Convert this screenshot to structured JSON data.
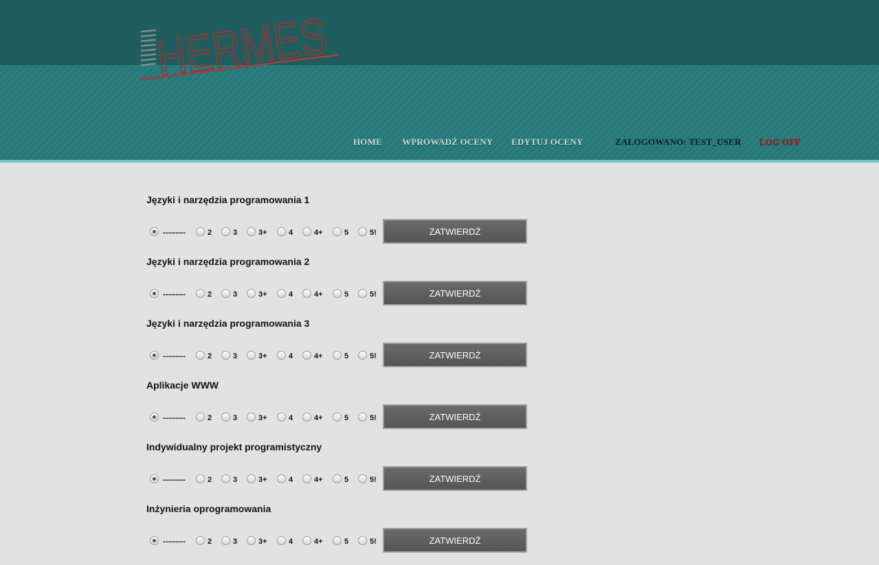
{
  "header": {
    "logo_text": "HERMES",
    "nav": {
      "home": "HOME",
      "enter_grades": "WPROWADŹ OCENY",
      "edit_grades": "EDYTUJ OCENY",
      "logged_in": "ZALOGOWANO: TEST_USER",
      "log_off": "LOG OFF"
    }
  },
  "grade_options": [
    "---------",
    "2",
    "3",
    "3+",
    "4",
    "4+",
    "5",
    "5!"
  ],
  "selected_option": "---------",
  "submit_label": "ZATWIERDŹ",
  "courses": [
    {
      "title": "Języki i narzędzia programowania 1"
    },
    {
      "title": "Języki i narzędzia programowania 2"
    },
    {
      "title": "Języki i narzędzia programowania 3"
    },
    {
      "title": "Aplikacje WWW"
    },
    {
      "title": "Indywidualny projekt programistyczny"
    },
    {
      "title": "Inżynieria oprogramowania"
    }
  ],
  "colors": {
    "header_dark": "#1f5d5e",
    "header_light": "#27787a",
    "accent_line": "#74c7c9",
    "logo": "#8b3a3a",
    "log_off": "#b31212",
    "button": "#5e5e5e"
  }
}
